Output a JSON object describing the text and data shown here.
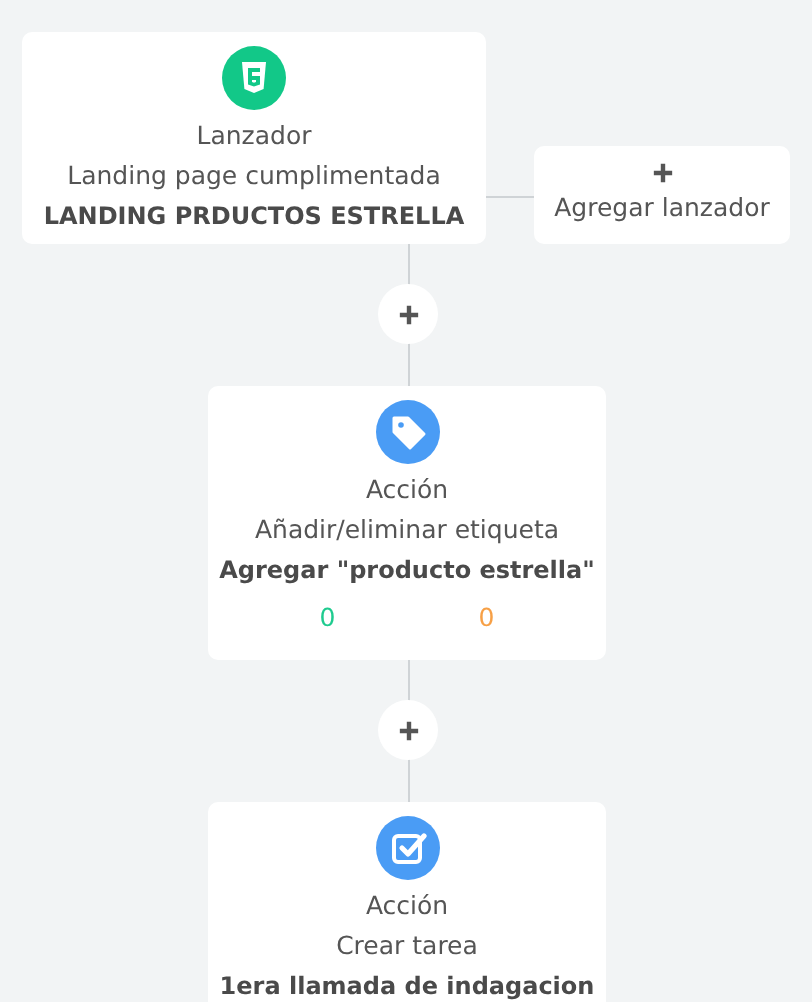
{
  "trigger": {
    "kind": "landing",
    "title": "Lanzador",
    "event": "Landing page cumplimentada",
    "name": "LANDING PRDUCTOS ESTRELLA"
  },
  "add_trigger": {
    "label": "Agregar lanzador"
  },
  "actions": [
    {
      "kind": "tag",
      "title": "Acción",
      "type": "Añadir/eliminar etiqueta",
      "detail": "Agregar \"producto estrella\"",
      "counts": [
        {
          "value": "0",
          "color": "#1fcb8f"
        },
        {
          "value": "0",
          "color": "#f7a046"
        }
      ]
    },
    {
      "kind": "task",
      "title": "Acción",
      "type": "Crear tarea",
      "detail": "1era llamada de indagacion"
    }
  ]
}
